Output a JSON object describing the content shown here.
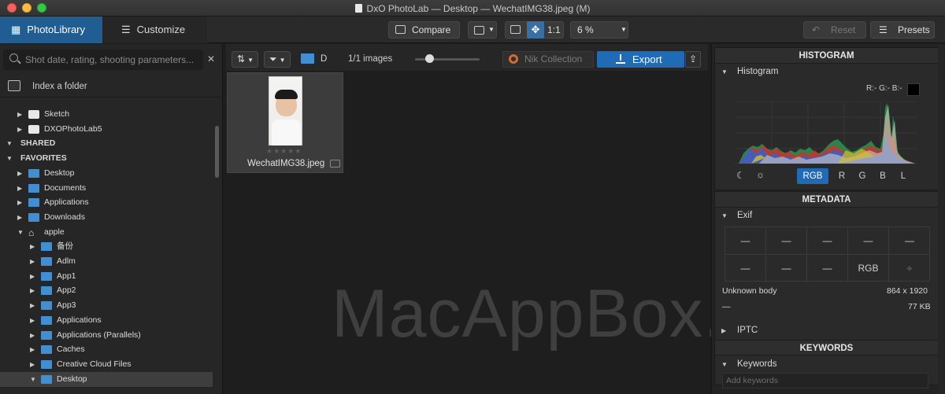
{
  "window": {
    "title": "DxO PhotoLab — Desktop — WechatIMG38.jpeg (M)"
  },
  "toolbar": {
    "tab_library": "PhotoLibrary",
    "tab_customize": "Customize",
    "compare": "Compare",
    "one_to_one": "1:1",
    "zoom": "6 %",
    "reset": "Reset",
    "presets": "Presets"
  },
  "left": {
    "search_placeholder": "Shot date, rating, shooting parameters...",
    "index_folder": "Index a folder",
    "tree": [
      {
        "label": "Sketch",
        "type": "drive",
        "section": false
      },
      {
        "label": "DXOPhotoLab5",
        "type": "drive",
        "section": false
      },
      {
        "label": "SHARED",
        "type": "section",
        "section": true
      },
      {
        "label": "FAVORITES",
        "type": "section",
        "section": true
      },
      {
        "label": "Desktop",
        "type": "folder",
        "section": false
      },
      {
        "label": "Documents",
        "type": "folder",
        "section": false
      },
      {
        "label": "Applications",
        "type": "folder",
        "section": false
      },
      {
        "label": "Downloads",
        "type": "folder",
        "section": false
      },
      {
        "label": "apple",
        "type": "home",
        "section": false
      },
      {
        "label": "备份",
        "type": "folder",
        "section": false
      },
      {
        "label": "Adlm",
        "type": "folder",
        "section": false
      },
      {
        "label": "App1",
        "type": "folder",
        "section": false
      },
      {
        "label": "App2",
        "type": "folder",
        "section": false
      },
      {
        "label": "App3",
        "type": "folder",
        "section": false
      },
      {
        "label": "Applications",
        "type": "folder",
        "section": false
      },
      {
        "label": "Applications (Parallels)",
        "type": "folder",
        "section": false
      },
      {
        "label": "Caches",
        "type": "folder",
        "section": false
      },
      {
        "label": "Creative Cloud Files",
        "type": "folder",
        "section": false
      },
      {
        "label": "Desktop",
        "type": "folder",
        "section": false
      }
    ]
  },
  "center": {
    "folder_label": "D",
    "image_count": "1/1 images",
    "nik": "Nik Collection",
    "export": "Export",
    "thumb_name": "WechatIMG38.jpeg",
    "stars": "★★★★★",
    "watermark": "MacAppBox.com"
  },
  "right": {
    "histogram": {
      "title": "HISTOGRAM",
      "sub": "Histogram",
      "rgb_readout": "R:- G:- B:-",
      "buttons": [
        "RGB",
        "R",
        "G",
        "B",
        "L"
      ]
    },
    "metadata": {
      "title": "METADATA",
      "sub": "Exif",
      "cells": [
        "—",
        "—",
        "—",
        "—",
        "—",
        "—",
        "—",
        "—",
        "RGB",
        ""
      ],
      "camera": "Unknown body",
      "dims": "864 x 1920",
      "lens": "—",
      "size": "77 KB",
      "iptc": "IPTC"
    },
    "keywords": {
      "title": "KEYWORDS",
      "sub": "Keywords",
      "placeholder": "Add keywords"
    }
  }
}
